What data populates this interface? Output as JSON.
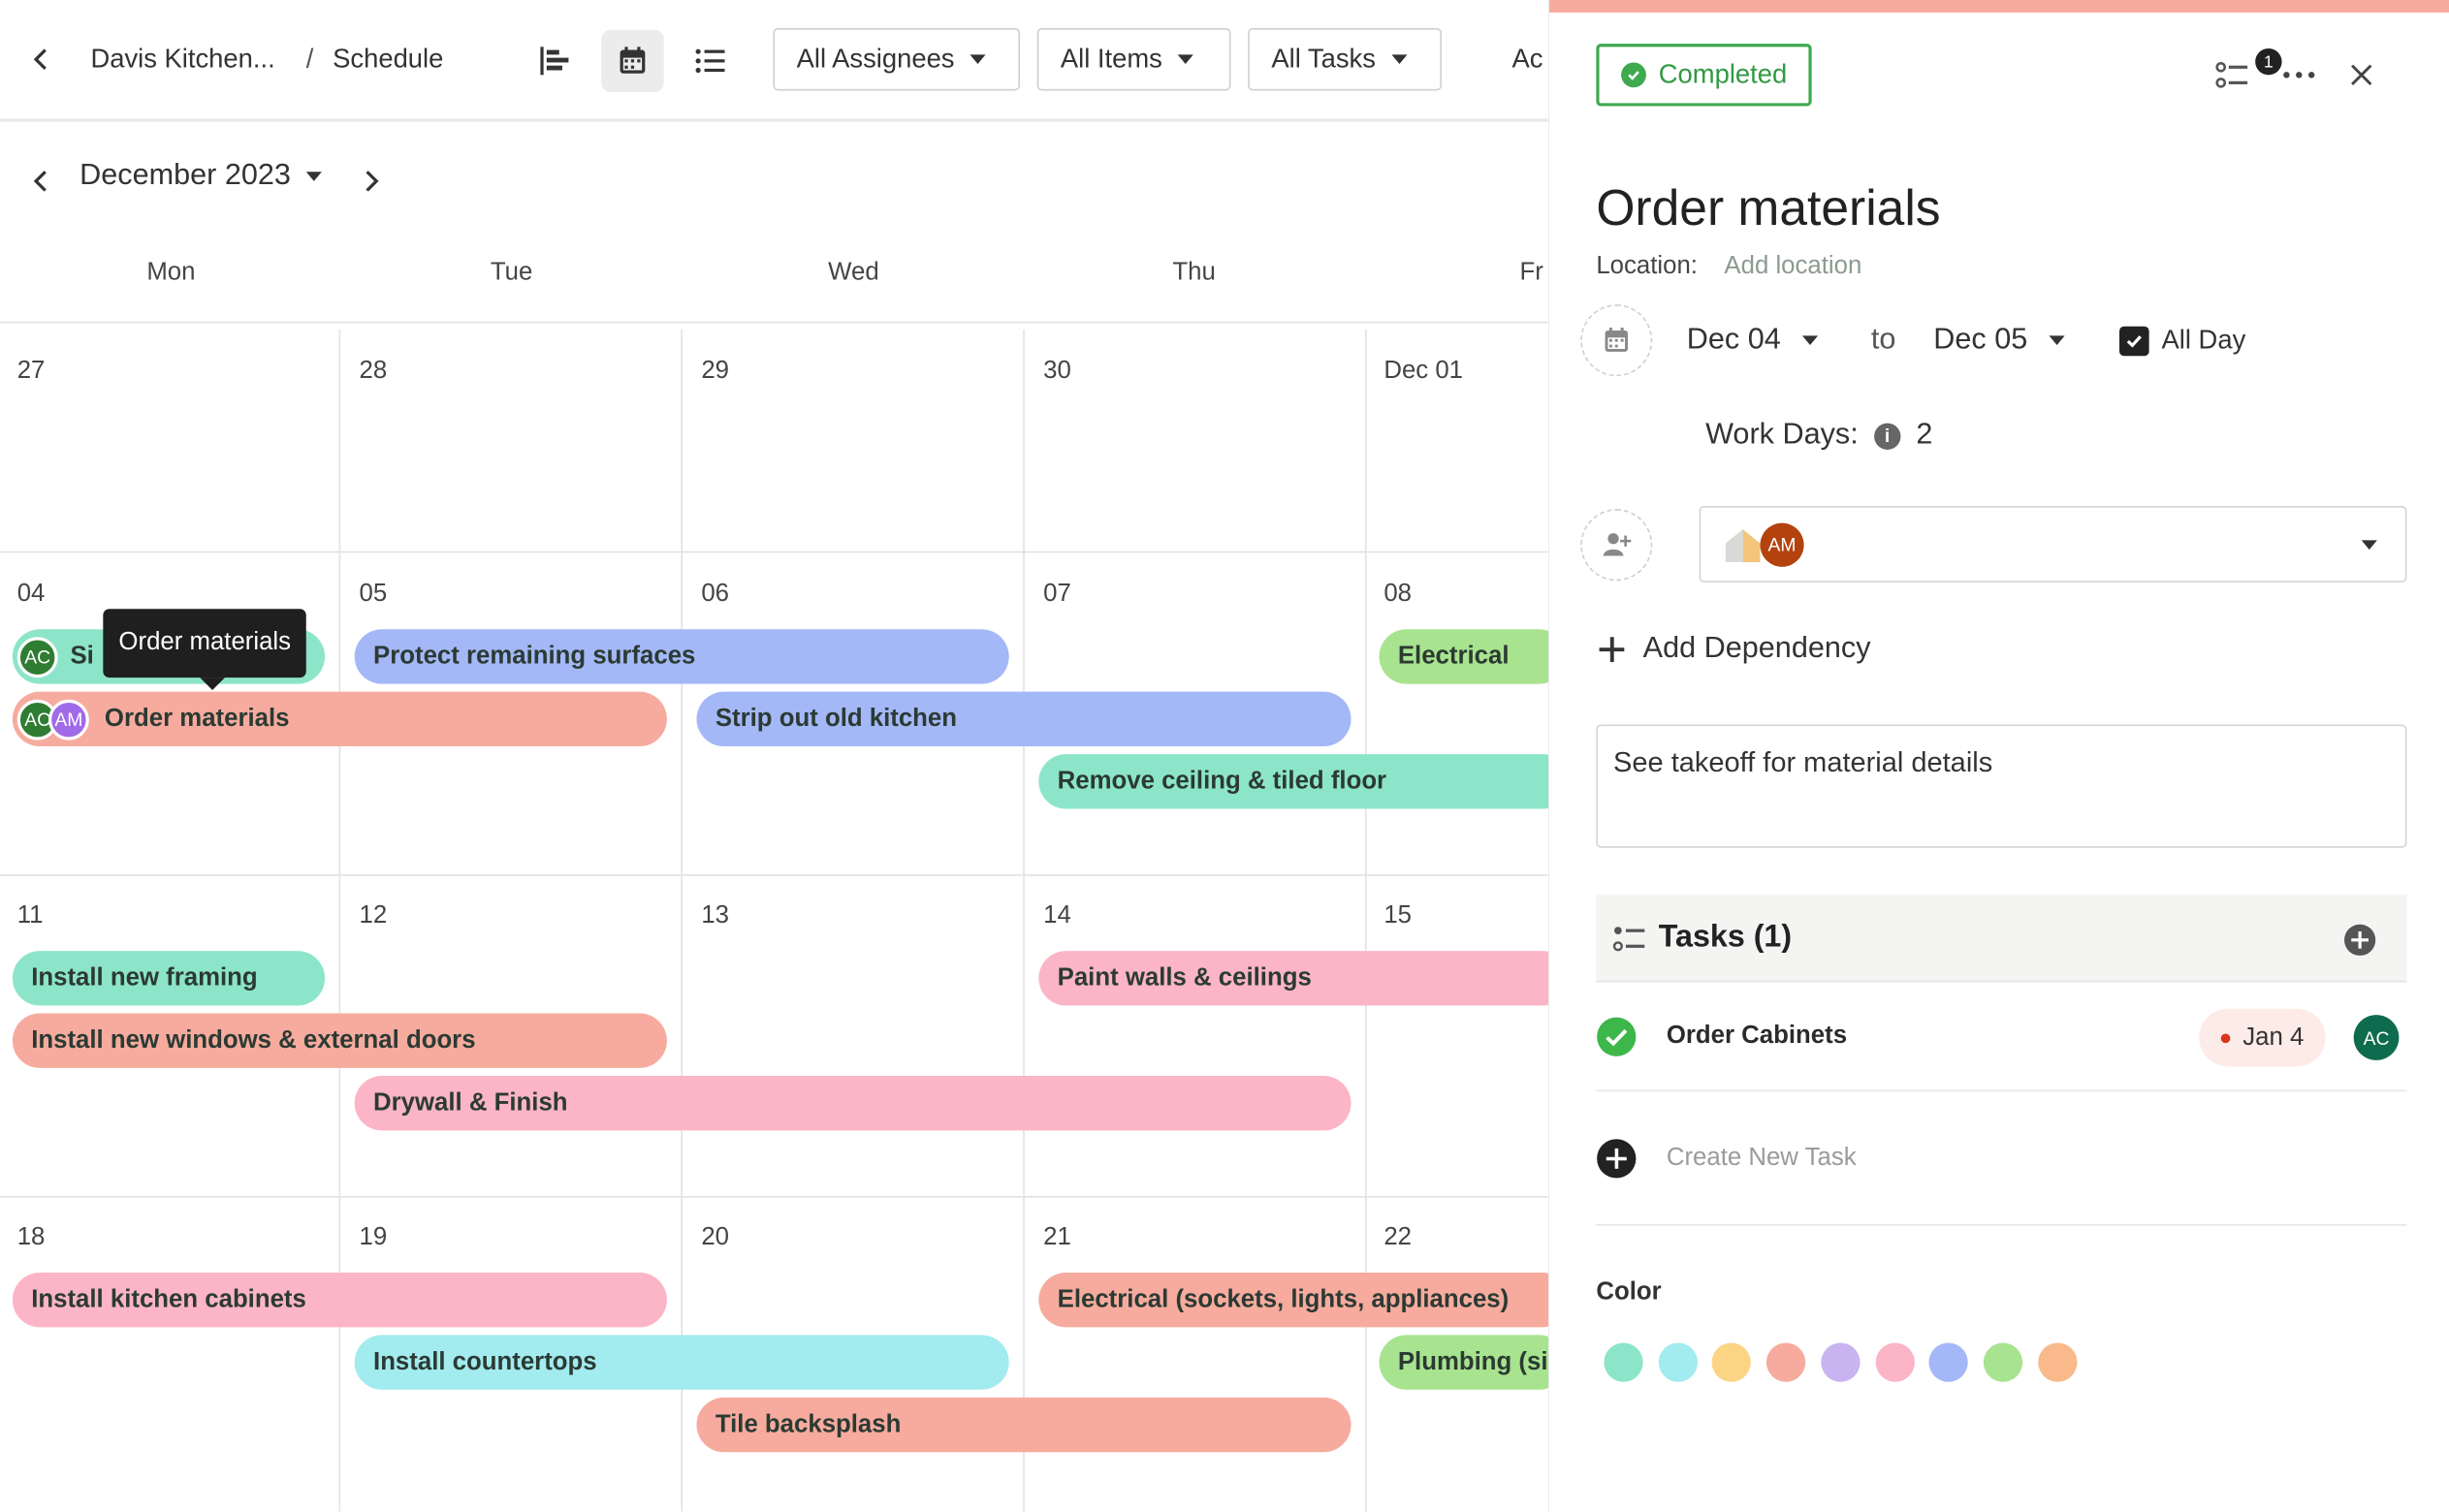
{
  "topbar": {
    "project": "Davis Kitchen...",
    "separator": "/",
    "section": "Schedule",
    "filters": [
      "All Assignees",
      "All Items",
      "All Tasks"
    ],
    "more_label": "Ac"
  },
  "calendar": {
    "month": "December 2023",
    "weekdays": [
      "Mon",
      "Tue",
      "Wed",
      "Thu",
      "Fr"
    ],
    "weeks": [
      [
        "27",
        "28",
        "29",
        "30",
        "Dec 01"
      ],
      [
        "04",
        "05",
        "06",
        "07",
        "08"
      ],
      [
        "11",
        "12",
        "13",
        "14",
        "15"
      ],
      [
        "18",
        "19",
        "20",
        "21",
        "22"
      ]
    ],
    "events": [
      {
        "title": "Si",
        "color": "#8de5c9",
        "avatars": [
          "AC"
        ]
      },
      {
        "title": "Order materials",
        "color": "#f6ab9e",
        "avatars": [
          "AC",
          "AM"
        ]
      },
      {
        "title": "Protect remaining surfaces",
        "color": "#a4b8f7"
      },
      {
        "title": "Strip out old kitchen",
        "color": "#a4b8f7"
      },
      {
        "title": "Remove ceiling & tiled floor",
        "color": "#8de5c9"
      },
      {
        "title": "Electrical",
        "color": "#a8e38f"
      },
      {
        "title": "Install new framing",
        "color": "#8de5c9"
      },
      {
        "title": "Install new windows & external doors",
        "color": "#f6ab9e"
      },
      {
        "title": "Drywall & Finish",
        "color": "#fbb5c6"
      },
      {
        "title": "Paint walls & ceilings",
        "color": "#fbb5c6"
      },
      {
        "title": "Install kitchen cabinets",
        "color": "#fbb5c6"
      },
      {
        "title": "Install countertops",
        "color": "#a2ebef"
      },
      {
        "title": "Tile backsplash",
        "color": "#f6ab9e"
      },
      {
        "title": "Electrical (sockets, lights, appliances)",
        "color": "#f6ab9e"
      },
      {
        "title": "Plumbing (si",
        "color": "#a8e38f"
      }
    ],
    "tooltip": "Order materials"
  },
  "panel": {
    "status": "Completed",
    "subtask_badge": "1",
    "title": "Order materials",
    "location_label": "Location:",
    "location_link": "Add location",
    "start_date": "Dec 04",
    "to_label": "to",
    "end_date": "Dec 05",
    "all_day_label": "All Day",
    "work_days_label": "Work Days:",
    "work_days_value": "2",
    "assignee_avatars": [
      "AM"
    ],
    "add_dependency": "Add Dependency",
    "notes": "See takeoff for material details",
    "tasks_title": "Tasks (1)",
    "tasks": [
      {
        "name": "Order Cabinets",
        "date": "Jan 4",
        "assignee": "AC"
      }
    ],
    "create_task": "Create New Task",
    "color_label": "Color",
    "colors": [
      "#8de5c9",
      "#a2ebef",
      "#fbd584",
      "#f6ab9e",
      "#c9b3f0",
      "#fbb5c6",
      "#a4b8f7",
      "#a8e38f",
      "#f9b98a"
    ]
  }
}
